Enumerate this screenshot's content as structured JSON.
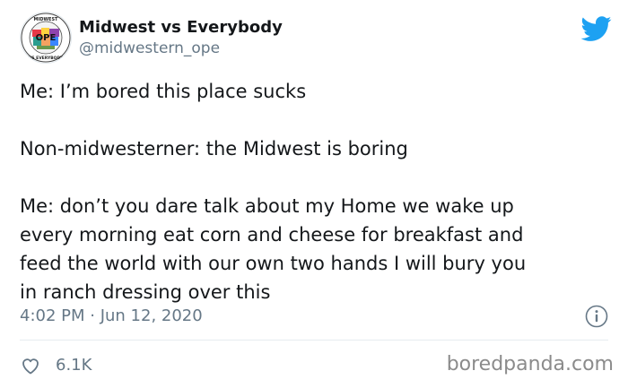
{
  "author": {
    "display_name": "Midwest vs Everybody",
    "handle": "@midwestern_ope",
    "avatar_text": "OPE",
    "avatar_ring_top": "MIDWEST",
    "avatar_ring_bottom": "VS EVERYBODY"
  },
  "tweet": {
    "paragraphs": [
      "Me: I’m bored this place sucks",
      "Non-midwesterner: the Midwest is boring",
      "Me: don’t you dare talk about my Home we wake up\nevery morning eat corn and cheese for breakfast and\nfeed the world with our own two hands I will bury you\nin ranch dressing over this"
    ],
    "timestamp": "4:02 PM · Jun 12, 2020",
    "like_count": "6.1K"
  },
  "icons": {
    "brand": "twitter-bird-icon",
    "info": "info-icon",
    "like": "heart-icon"
  },
  "colors": {
    "brand_blue": "#1da1f2",
    "secondary_text": "#657786",
    "primary_text": "#14171a"
  },
  "watermark": "boredpanda.com"
}
